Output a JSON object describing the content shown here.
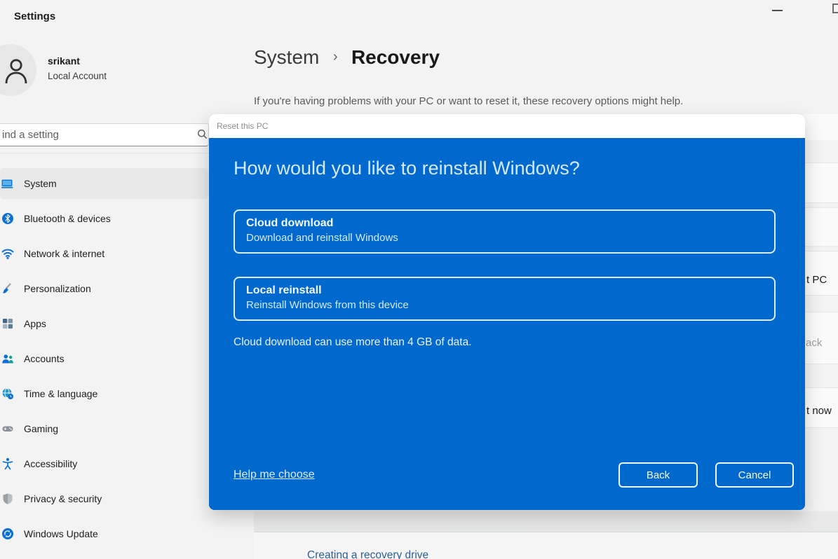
{
  "window": {
    "app_title": "Settings"
  },
  "account": {
    "name": "srikant",
    "type": "Local Account"
  },
  "search": {
    "value": "ind a setting"
  },
  "sidebar": {
    "items": [
      {
        "label": "System",
        "icon": "system-icon",
        "selected": true
      },
      {
        "label": "Bluetooth & devices",
        "icon": "bluetooth-icon",
        "selected": false
      },
      {
        "label": "Network & internet",
        "icon": "network-icon",
        "selected": false
      },
      {
        "label": "Personalization",
        "icon": "personalization-icon",
        "selected": false
      },
      {
        "label": "Apps",
        "icon": "apps-icon",
        "selected": false
      },
      {
        "label": "Accounts",
        "icon": "accounts-icon",
        "selected": false
      },
      {
        "label": "Time & language",
        "icon": "time-language-icon",
        "selected": false
      },
      {
        "label": "Gaming",
        "icon": "gaming-icon",
        "selected": false
      },
      {
        "label": "Accessibility",
        "icon": "accessibility-icon",
        "selected": false
      },
      {
        "label": "Privacy & security",
        "icon": "privacy-icon",
        "selected": false
      },
      {
        "label": "Windows Update",
        "icon": "windows-update-icon",
        "selected": false
      }
    ]
  },
  "page": {
    "breadcrumb_parent": "System",
    "breadcrumb_separator": "›",
    "breadcrumb_current": "Recovery",
    "description": "If you're having problems with your PC or want to reset it, these recovery options might help.",
    "fragments": {
      "reset_pc": "t PC",
      "go_back": "ack",
      "restart_now": "t now"
    },
    "footer_link": "Creating a recovery drive"
  },
  "dialog": {
    "titlebar": "Reset this PC",
    "heading": "How would you like to reinstall Windows?",
    "options": [
      {
        "title": "Cloud download",
        "subtitle": "Download and reinstall Windows"
      },
      {
        "title": "Local reinstall",
        "subtitle": "Reinstall Windows from this device"
      }
    ],
    "note": "Cloud download can use more than 4 GB of data.",
    "help_link": "Help me choose",
    "back_label": "Back",
    "cancel_label": "Cancel"
  },
  "colors": {
    "dialog_blue": "#0168cd",
    "accent": "#0c7bd6",
    "footer_link_blue": "#2a6099"
  }
}
